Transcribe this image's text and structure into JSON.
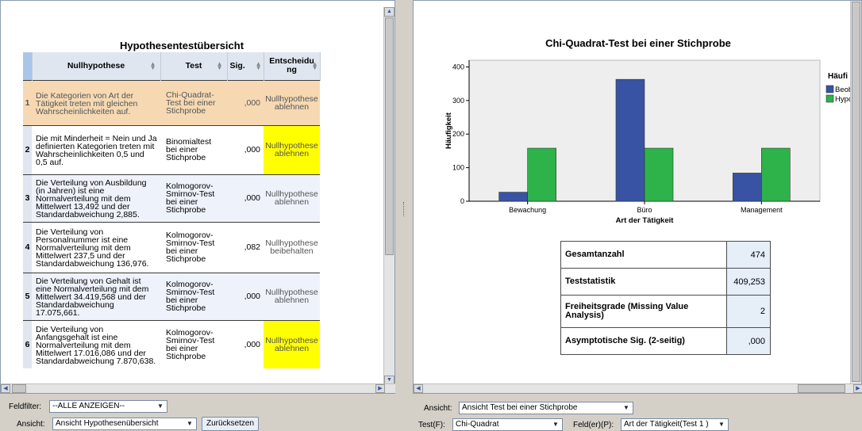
{
  "left": {
    "title": "Hypothesentestübersicht",
    "columns": [
      "Nullhypothese",
      "Test",
      "Sig.",
      "Entscheidung"
    ],
    "rows": [
      {
        "num": "1",
        "hypothesis": "Die Kategorien von Art der Tätigkeit treten mit gleichen Wahrscheinlichkeiten auf.",
        "test": "Chi-Quadrat-Test bei einer Stichprobe",
        "sig": ",000",
        "decision": "Nullhypothese ablehnen"
      },
      {
        "num": "2",
        "hypothesis": "Die mit Minderheit = Nein und Ja definierten Kategorien treten mit Wahrscheinlichkeiten 0,5 und 0,5 auf.",
        "test": "Binomialtest bei einer Stichprobe",
        "sig": ",000",
        "decision": "Nullhypothese ablehnen"
      },
      {
        "num": "3",
        "hypothesis": "Die Verteilung von Ausbildung (in Jahren) ist eine Normalverteilung mit dem Mittelwert 13,492 und der Standardabweichung 2,885.",
        "test": "Kolmogorov-Smirnov-Test bei einer Stichprobe",
        "sig": ",000",
        "decision": "Nullhypothese ablehnen"
      },
      {
        "num": "4",
        "hypothesis": "Die Verteilung von Personalnummer ist eine Normalverteilung mit dem Mittelwert 237,5 und der Standardabweichung 136,976.",
        "test": "Kolmogorov-Smirnov-Test bei einer Stichprobe",
        "sig": ",082",
        "decision": "Nullhypothese beibehalten"
      },
      {
        "num": "5",
        "hypothesis": "Die Verteilung von Gehalt ist eine Normalverteilung mit dem Mittelwert 34.419,568 und der Standardabweichung 17.075,661.",
        "test": "Kolmogorov-Smirnov-Test bei einer Stichprobe",
        "sig": ",000",
        "decision": "Nullhypothese ablehnen"
      },
      {
        "num": "6",
        "hypothesis": "Die Verteilung von Anfangsgehalt ist eine Normalverteilung mit dem Mittelwert 17.016,086 und der Standardabweichung 7.870,638.",
        "test": "Kolmogorov-Smirnov-Test bei einer Stichprobe",
        "sig": ",000",
        "decision": "Nullhypothese ablehnen"
      }
    ],
    "bottom": {
      "field_filter_label": "Feldfilter:",
      "field_filter_value": "--ALLE ANZEIGEN--",
      "view_label": "Ansicht:",
      "view_value": "Ansicht Hypothesenübersicht",
      "reset_label": "Zurücksetzen"
    }
  },
  "right": {
    "title": "Chi-Quadrat-Test bei einer Stichprobe",
    "stats": [
      {
        "label": "Gesamtanzahl",
        "value": "474"
      },
      {
        "label": "Teststatistik",
        "value": "409,253"
      },
      {
        "label": "Freiheitsgrade (Missing Value Analysis)",
        "value": "2"
      },
      {
        "label": "Asymptotische Sig. (2-seitig)",
        "value": ",000"
      }
    ],
    "bottom": {
      "view_label": "Ansicht:",
      "view_value": "Ansicht Test bei einer Stichprobe",
      "test_label": "Test(F):",
      "test_value": "Chi-Quadrat",
      "fields_label": "Feld(er)(P):",
      "fields_value": "Art der Tätigkeit(Test 1 )"
    }
  },
  "chart_data": {
    "type": "bar",
    "categories": [
      "Bewachung",
      "Büro",
      "Management"
    ],
    "series": [
      {
        "name": "Beob",
        "values": [
          27,
          363,
          84
        ],
        "color": "#3953a4"
      },
      {
        "name": "Hypo",
        "values": [
          158,
          158,
          158
        ],
        "color": "#2db34a"
      }
    ],
    "xlabel": "Art der Tätigkeit",
    "ylabel": "Häufigkeit",
    "ylim": [
      0,
      420
    ],
    "yticks": [
      0,
      100,
      200,
      300,
      400
    ],
    "legend_title": "Häufi",
    "legend": "right"
  }
}
